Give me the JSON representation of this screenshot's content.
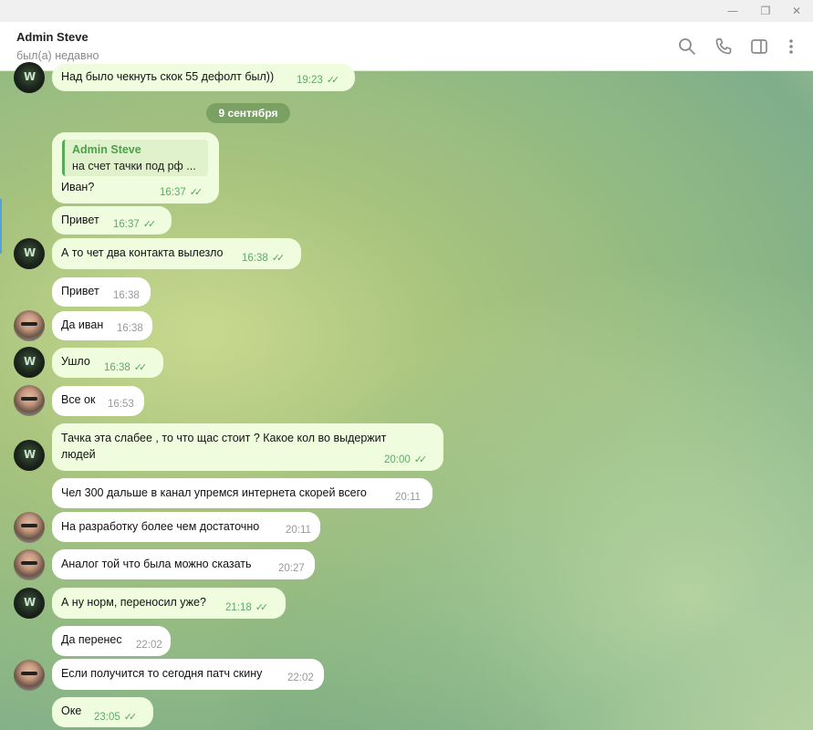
{
  "window": {
    "minimize": "—",
    "maximize": "❐",
    "close": "✕"
  },
  "header": {
    "name": "Admin Steve",
    "status": "был(а) недавно"
  },
  "date_separator": "9 сентября",
  "reply": {
    "name": "Admin Steve",
    "text": "на счет тачки под рф ..."
  },
  "messages": [
    {
      "text": "Над было чекнуть скок 55 дефолт был))",
      "time": "19:23"
    },
    {
      "text": "Иван?",
      "time": "16:37"
    },
    {
      "text": "Привет",
      "time": "16:37"
    },
    {
      "text": "А то чет два контакта вылезло",
      "time": "16:38"
    },
    {
      "text": "Привет",
      "time": "16:38"
    },
    {
      "text": "Да иван",
      "time": "16:38"
    },
    {
      "text": "Ушло",
      "time": "16:38"
    },
    {
      "text": "Все ок",
      "time": "16:53"
    },
    {
      "text_line1": "Тачка эта слабее , то что щас стоит ? Какое кол во выдержит",
      "text_line2": "людей",
      "time": "20:00"
    },
    {
      "text": "Чел 300 дальше в канал упремся интернета скорей всего",
      "time": "20:11"
    },
    {
      "text": "На разработку более чем достаточно",
      "time": "20:11"
    },
    {
      "text": "Аналог той что была можно сказать",
      "time": "20:27"
    },
    {
      "text": "А ну норм, переносил уже?",
      "time": "21:18"
    },
    {
      "text": "Да перенес",
      "time": "22:02"
    },
    {
      "text": "Если получится то сегодня патч скину",
      "time": "22:02"
    },
    {
      "text": "Оке",
      "time": "23:05"
    }
  ],
  "ticks": "✓✓",
  "icons": [
    "search-icon",
    "phone-icon",
    "sidebar-icon",
    "more-icon"
  ]
}
